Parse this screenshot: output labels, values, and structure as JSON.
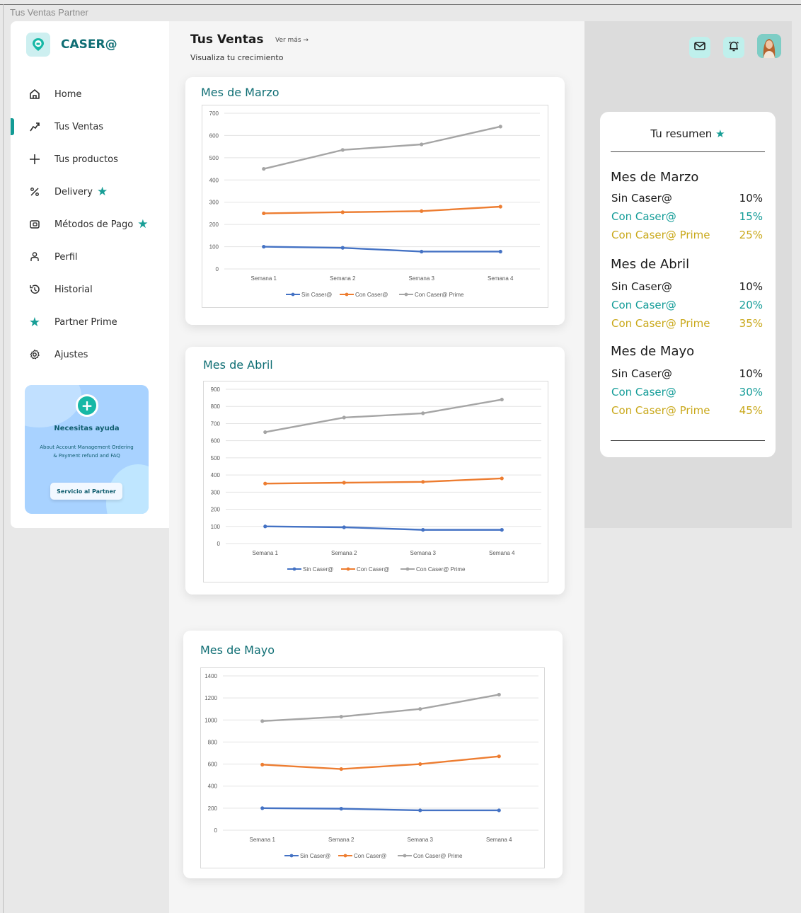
{
  "window": {
    "title": "Tus Ventas Partner"
  },
  "brand": {
    "name": "CASER@"
  },
  "nav": [
    {
      "label": "Home",
      "icon": "home-icon",
      "star": false,
      "active": false
    },
    {
      "label": "Tus Ventas",
      "icon": "trend-icon",
      "star": false,
      "active": true
    },
    {
      "label": "Tus productos",
      "icon": "plus-icon",
      "star": false,
      "active": false
    },
    {
      "label": "Delivery",
      "icon": "percent-icon",
      "star": true,
      "active": false
    },
    {
      "label": "Métodos de Pago",
      "icon": "wallet-icon",
      "star": true,
      "active": false
    },
    {
      "label": "Perfil",
      "icon": "user-icon",
      "star": false,
      "active": false
    },
    {
      "label": "Historial",
      "icon": "history-icon",
      "star": false,
      "active": false
    },
    {
      "label": "Partner Prime",
      "icon": "star-icon",
      "star": false,
      "active": false
    },
    {
      "label": "Ajustes",
      "icon": "settings-icon",
      "star": false,
      "active": false
    }
  ],
  "help": {
    "title": "Necesitas ayuda",
    "description": "About Account Management Ordering & Payment refund and FAQ",
    "button": "Servicio al Partner"
  },
  "header": {
    "title": "Tus Ventas",
    "link": "Ver más →",
    "subtitle": "Visualiza tu crecimiento"
  },
  "colors": {
    "sin": "#4472c4",
    "con": "#ed7d31",
    "prime": "#a5a5a5",
    "teal": "#149c98",
    "gold": "#c9a81a"
  },
  "chart_data": [
    {
      "type": "line",
      "title": "Mes de Marzo",
      "categories": [
        "Semana 1",
        "Semana 2",
        "Semana 3",
        "Semana 4"
      ],
      "ylim": [
        0,
        700
      ],
      "yticks": [
        0,
        100,
        200,
        300,
        400,
        500,
        600,
        700
      ],
      "series": [
        {
          "name": "Sin Caser@",
          "values": [
            100,
            95,
            78,
            78
          ]
        },
        {
          "name": "Con Caser@",
          "values": [
            250,
            255,
            260,
            280
          ]
        },
        {
          "name": "Con Caser@ Prime",
          "values": [
            450,
            535,
            560,
            640
          ]
        }
      ],
      "legend": "bottom",
      "grid": true
    },
    {
      "type": "line",
      "title": "Mes de Abril",
      "categories": [
        "Semana 1",
        "Semana 2",
        "Semana 3",
        "Semana 4"
      ],
      "ylim": [
        0,
        900
      ],
      "yticks": [
        0,
        100,
        200,
        300,
        400,
        500,
        600,
        700,
        800,
        900
      ],
      "series": [
        {
          "name": "Sin Caser@",
          "values": [
            100,
            95,
            80,
            80
          ]
        },
        {
          "name": "Con Caser@",
          "values": [
            350,
            355,
            360,
            380
          ]
        },
        {
          "name": "Con Caser@ Prime",
          "values": [
            650,
            735,
            760,
            840
          ]
        }
      ],
      "legend": "bottom",
      "grid": true
    },
    {
      "type": "line",
      "title": "Mes de Mayo",
      "categories": [
        "Semana 1",
        "Semana 2",
        "Semana 3",
        "Semana 4"
      ],
      "ylim": [
        0,
        1400
      ],
      "yticks": [
        0,
        200,
        400,
        600,
        800,
        1000,
        1200,
        1400
      ],
      "series": [
        {
          "name": "Sin Caser@",
          "values": [
            200,
            195,
            180,
            180
          ]
        },
        {
          "name": "Con Caser@",
          "values": [
            595,
            555,
            600,
            670
          ]
        },
        {
          "name": "Con Caser@ Prime",
          "values": [
            990,
            1030,
            1100,
            1230
          ]
        }
      ],
      "legend": "bottom",
      "grid": true
    }
  ],
  "summary": {
    "title": "Tu resumen",
    "months": [
      {
        "name": "Mes de Marzo",
        "rows": [
          {
            "label": "Sin Caser@",
            "value": "10%",
            "tone": "black"
          },
          {
            "label": "Con Caser@",
            "value": "15%",
            "tone": "teal"
          },
          {
            "label": "Con Caser@ Prime",
            "value": "25%",
            "tone": "gold"
          }
        ]
      },
      {
        "name": "Mes de Abril",
        "rows": [
          {
            "label": "Sin Caser@",
            "value": "10%",
            "tone": "black"
          },
          {
            "label": "Con Caser@",
            "value": "20%",
            "tone": "teal"
          },
          {
            "label": "Con Caser@ Prime",
            "value": "35%",
            "tone": "gold"
          }
        ]
      },
      {
        "name": "Mes de Mayo",
        "rows": [
          {
            "label": "Sin Caser@",
            "value": "10%",
            "tone": "black"
          },
          {
            "label": "Con Caser@",
            "value": "30%",
            "tone": "teal"
          },
          {
            "label": "Con Caser@ Prime",
            "value": "45%",
            "tone": "gold"
          }
        ]
      }
    ]
  }
}
